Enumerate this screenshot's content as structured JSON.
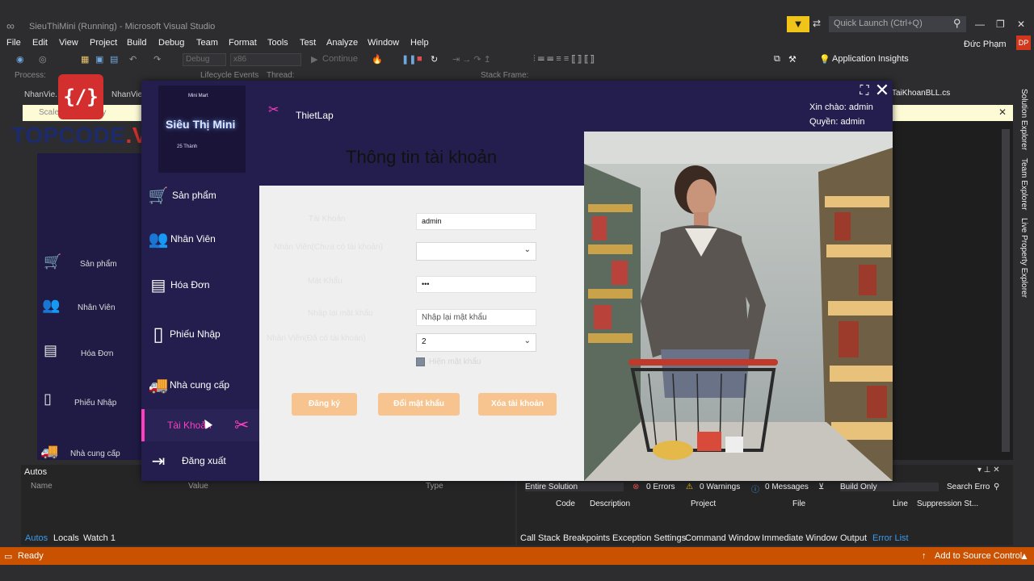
{
  "vs": {
    "title": "SieuThiMini (Running) - Microsoft Visual Studio",
    "quick_launch_placeholder": "Quick Launch (Ctrl+Q)",
    "menu": [
      "File",
      "Edit",
      "View",
      "Project",
      "Build",
      "Debug",
      "Team",
      "Format",
      "Tools",
      "Test",
      "Analyze",
      "Window",
      "Help"
    ],
    "user_name": "Đức Phạm",
    "user_initials": "DP",
    "toolbar": {
      "config": "Debug",
      "platform": "x86",
      "continue": "Continue",
      "app_insights": "Application Insights"
    },
    "debug_row": {
      "process_label": "Process:",
      "lifecycle": "Lifecycle Events",
      "thread": "Thread:",
      "stack_frame": "Stack Frame:"
    },
    "bg_tabs": [
      "NhanVie...",
      "NhanVien"
    ],
    "bg_info_text": "Scale... ain display",
    "right_tab": "TaiKhoanBLL.cs",
    "right_vtabs": [
      "Solution Explorer",
      "Team Explorer",
      "Live Property Explorer"
    ],
    "bg_nav": [
      {
        "label": "Sản phẩm"
      },
      {
        "label": "Nhân Viên"
      },
      {
        "label": "Hóa Đơn"
      },
      {
        "label": "Phiếu Nhập"
      },
      {
        "label": "Nhà cung cấp"
      }
    ],
    "autos": {
      "title": "Autos",
      "columns": [
        "Name",
        "Value",
        "Type"
      ],
      "tabs": [
        "Autos",
        "Locals",
        "Watch 1"
      ]
    },
    "error_list": {
      "scope": "Entire Solution",
      "errors": "0 Errors",
      "warnings": "0 Warnings",
      "messages": "0 Messages",
      "build": "Build Only",
      "search": "Search Erro",
      "columns": [
        "Code",
        "Description",
        "Project",
        "File",
        "Line",
        "Suppression St..."
      ],
      "tabs": [
        "Call Stack",
        "Breakpoints",
        "Exception Settings",
        "Command Window",
        "Immediate Window",
        "Output",
        "Error List"
      ]
    },
    "status": {
      "ready": "Ready",
      "source_control": "Add to Source Control"
    },
    "colors": {
      "status_bar": "#ca5100",
      "ide_bg": "#2d2d30"
    }
  },
  "watermark": {
    "badge": "{/}",
    "text_dark": "TOPCODE",
    "text_red": ".VN"
  },
  "app": {
    "logo": {
      "small": "Mini Mart",
      "main": "Siêu Thị Mini",
      "sub": "25 Thành"
    },
    "nav": [
      {
        "label": "Sản phẩm",
        "icon": "cart-icon"
      },
      {
        "label": "Nhân Viên",
        "icon": "people-icon"
      },
      {
        "label": "Hóa Đơn",
        "icon": "invoice-icon"
      },
      {
        "label": "Phiếu Nhập",
        "icon": "document-icon"
      },
      {
        "label": "Nhà cung cấp",
        "icon": "truck-icon"
      },
      {
        "label": "Tài Khoản",
        "icon": "tools-icon",
        "active": true
      },
      {
        "label": "Đăng xuất",
        "icon": "logout-icon"
      }
    ],
    "header": {
      "section": "ThietLap",
      "greeting": "Xin chào: admin",
      "role": "Quyền: admin"
    },
    "form": {
      "title": "Thông tin tài khoản",
      "labels": {
        "username": "Tài Khoản",
        "employee_no_account": "Nhân Viên(Chưa có tài khoản)",
        "password": "Mật Khẩu",
        "confirm_password": "Nhập lại mật khẩu",
        "employee_with_account": "Nhân Viên(Đã có tài khoản)",
        "show_password": "Hiện mật khẩu"
      },
      "values": {
        "username": "admin",
        "employee_no_account": "",
        "password": "•••",
        "confirm_placeholder": "Nhập lại mật khẩu",
        "employee_with_account": "2"
      },
      "buttons": {
        "register": "Đăng ký",
        "change_password": "Đổi mật khẩu",
        "delete_account": "Xóa tài khoản"
      }
    },
    "colors": {
      "sidebar": "#231e4d",
      "accent": "#ff3ec0",
      "button": "#f7c48f"
    }
  }
}
